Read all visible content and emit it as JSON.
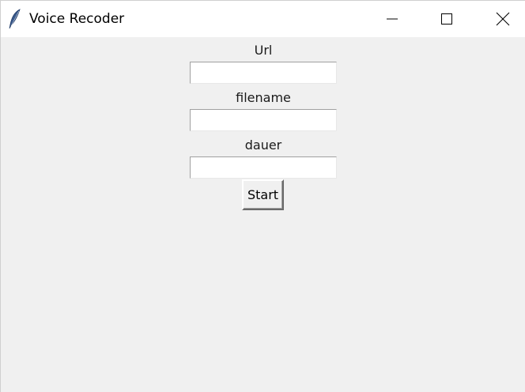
{
  "window": {
    "title": "Voice Recoder",
    "app_icon": "feather-icon",
    "controls": {
      "minimize_icon": "minimize-icon",
      "maximize_icon": "maximize-icon",
      "close_icon": "close-icon"
    }
  },
  "form": {
    "url": {
      "label": "Url",
      "value": ""
    },
    "filename": {
      "label": "filename",
      "value": ""
    },
    "dauer": {
      "label": "dauer",
      "value": ""
    },
    "start_label": "Start"
  },
  "colors": {
    "background": "#f0f0f0",
    "titlebar": "#ffffff"
  }
}
